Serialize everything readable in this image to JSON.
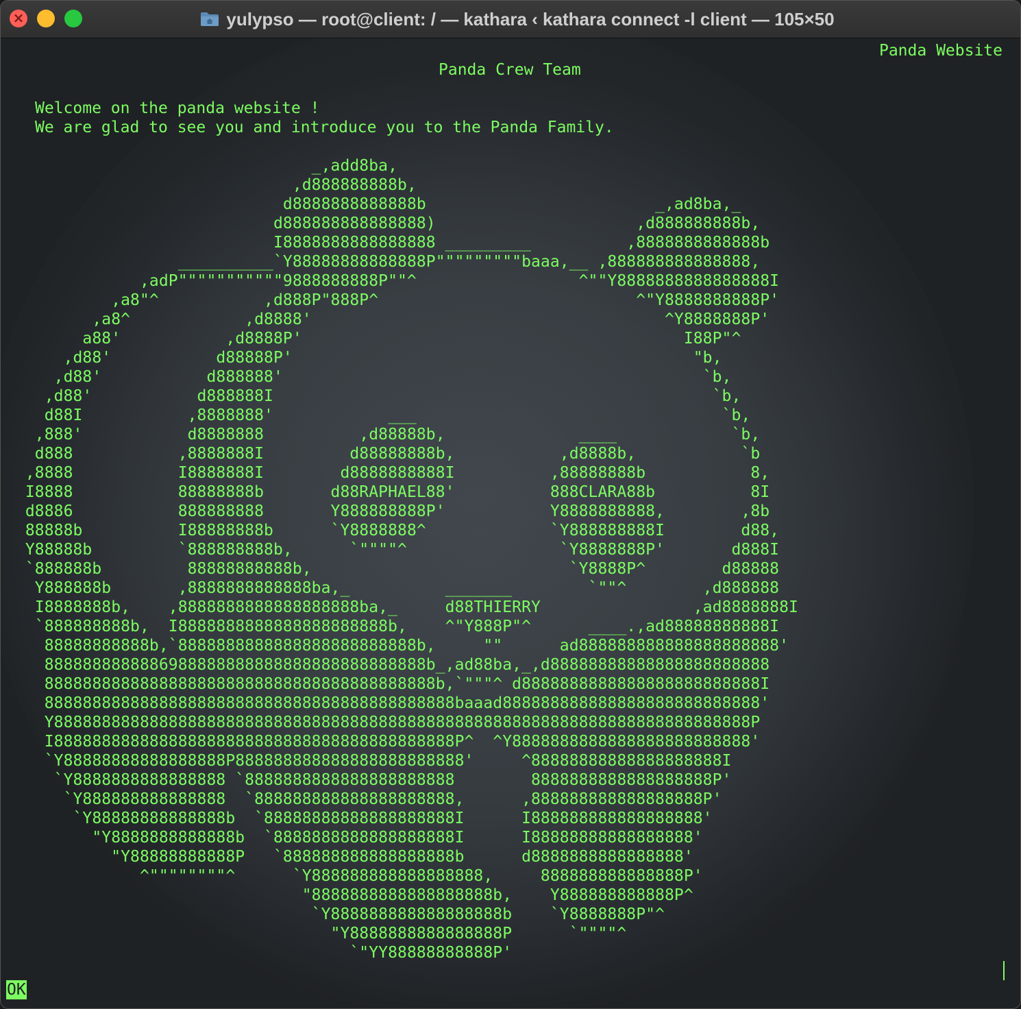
{
  "window": {
    "title": "yulypso — root@client: / — kathara ‹ kathara connect -l client — 105×50"
  },
  "terminal": {
    "site_title": "Panda Website",
    "crew_title": "Panda Crew Team",
    "welcome_line_1": "Welcome on the panda website !",
    "welcome_line_2": "We are glad to see you and introduce you to the Panda Family.",
    "ascii_art": "                                _,add8ba,\n                              ,d888888888b,\n                             d8888888888888b                        _,ad8ba,_\n                            d888888888888888)                     ,d888888888b,\n                            I8888888888888888 _________          ,8888888888888b\n                  __________`Y88888888888888P\"\"\"\"\"\"\"\"\"baaa,__ ,888888888888888,\n              ,adP\"\"\"\"\"\"\"\"\"\"\"9888888888P\"\"^                 ^\"\"Y8888888888888888I\n           ,a8\"^           ,d888P\"888P^                           ^\"Y8888888888P'\n         ,a8^            ,d8888'                                     ^Y8888888P'\n        a88'           ,d8888P'                                        I88P\"^\n      ,d88'           d88888P'                                          \"b,\n     ,d88'           d888888'                                            `b,\n    ,d88'           d888888I                                              `b,\n    d88I           ,8888888'            ___                                `b,\n   ,888'           d8888888          ,d88888b,              ____            `b,\n   d888           ,8888888I         d88888888b,           ,d8888b,           `b\n  ,8888           I8888888I        d8888888888I          ,88888888b           8,\n  I8888           88888888b       d88RAPHAEL88'          888CLARA88b          8I\n  d8886           888888888       Y888888888P'           Y8888888888,        ,8b\n  88888b          I88888888b      `Y8888888^             `Y888888888I        d88,\n  Y88888b         `888888888b,      `\"\"\"\"^                `Y8888888P'       d888I\n  `888888b         88888888888b,                           `Y8888P^        d88888\n   Y888888b       ,8888888888888ba,_          _______        `\"\"^        ,d888888\n   I8888888b,    ,8888888888888888888ba,_     d88THIERRY                ,ad8888888I\n   `888888888b,  I8888888888888888888888b,    ^\"Y888P\"^      ____.,ad88888888888I\n    88888888888b,`8888888888888888888888888b,     \"\"      ad888888888888888888888'\n    8888888888886988888888888888888888888888b_,ad88ba,_,d88888888888888888888888\n    88888888888888888888888888888888888888888b,`\"\"\"^ d8888888888888888888888888I\n    8888888888888888888888888888888888888888888baaad888888888888888888888888888'\n    Y8888888888888888888888888888888888888888888888888888888888888888888888888P\n    I888888888888888888888888888888888888888888P^  ^Y8888888888888888888888888'\n    `Y88888888888888888P888888888888888888888888'     ^88888888888888888888I\n     `Y8888888888888888 `8888888888888888888888        8888888888888888888P'\n      `Y888888888888888  `888888888888888888888,      ,888888888888888888P'\n       `Y88888888888888b  `88888888888888888888I      I888888888888888888'\n         \"Y8888888888888b  `8888888888888888888I      I88888888888888888'\n           \"Y88888888888P   `888888888888888888b      d8888888888888888'\n              ^\"\"\"\"\"\"\"\"^      `Y888888888888888888,     888888888888888P'\n                               \"8888888888888888888b,    Y888888888888P^\n                                `Y888888888888888888b    `Y8888888P\"^\n                                  \"Y8888888888888888P      `\"\"\"\"^\n                                    `\"YY88888888888P'",
    "status_label": "OK"
  },
  "colors": {
    "terminal_green": "#7dfc62",
    "background": "#1f2224",
    "close": "#ff5f57",
    "minimize": "#febc2e",
    "maximize": "#28c840"
  },
  "icons": {
    "title_icon": "folder-icon"
  }
}
